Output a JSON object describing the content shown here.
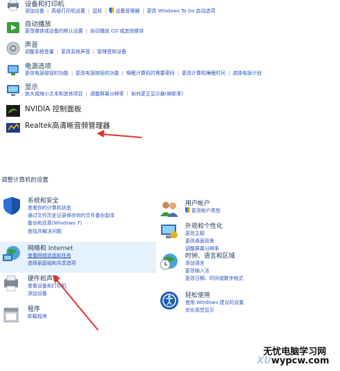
{
  "top_categories": [
    {
      "title": "设备和打印机",
      "icon": "printer-icon",
      "links": [
        "添加设备",
        "高级打印机设置",
        "鼠标",
        "设备管理器",
        "更改 Windows To Go 启动选项"
      ]
    },
    {
      "title": "自动播放",
      "icon": "autoplay-icon",
      "links": [
        "更改媒体或设备的默认设置",
        "自动播放 CD 或其他媒体"
      ]
    },
    {
      "title": "声音",
      "icon": "speaker-icon",
      "links": [
        "调整系统音量",
        "更改系统声音",
        "管理音频设备"
      ]
    },
    {
      "title": "电源选项",
      "icon": "power-icon",
      "links": [
        "更改电源按钮的功能",
        "更改电源按钮的功能",
        "唤醒计算机时需要密码",
        "更改计算机睡眠时间",
        "选择电源计划"
      ]
    },
    {
      "title": "显示",
      "icon": "display-icon",
      "links": [
        "放大或缩小文本和其他项目",
        "调整屏幕分辨率",
        "如何更正显示器(刷新率)"
      ]
    },
    {
      "title": "NVIDIA 控制面板",
      "icon": "nvidia-icon",
      "links": []
    },
    {
      "title": "Realtek高清晰音频管理器",
      "icon": "realtek-icon",
      "links": []
    }
  ],
  "section_heading": "调整计算机的设置",
  "left_column": [
    {
      "title": "系统和安全",
      "icon": "shield-icon",
      "links": [
        "查看你的计算机状态",
        "通过文件历史记录保存你的文件备份副本",
        "备份和还原(Windows 7)",
        "查找并解决问题"
      ]
    },
    {
      "title": "网络和 Internet",
      "icon": "network-icon",
      "links": [
        "查看网络状态和任务",
        "选择家庭组和共享选项"
      ]
    },
    {
      "title": "硬件和声音",
      "icon": "hardware-icon",
      "links": [
        "查看设备和打印机",
        "添加设备"
      ]
    },
    {
      "title": "程序",
      "icon": "programs-icon",
      "links": [
        "卸载程序"
      ]
    }
  ],
  "right_column": [
    {
      "title": "用户帐户",
      "icon": "users-icon",
      "links": [
        "更改帐户类型"
      ]
    },
    {
      "title": "外观和个性化",
      "icon": "appearance-icon",
      "links": [
        "更改主题",
        "更改桌面背景",
        "调整屏幕分辨率"
      ]
    },
    {
      "title": "时钟、语言和区域",
      "icon": "clock-globe-icon",
      "links": [
        "添加语言",
        "更改输入法",
        "更改日期、时间或数字格式"
      ]
    },
    {
      "title": "轻松使用",
      "icon": "ease-of-access-icon",
      "links": [
        "使用 Windows 建议的设置",
        "优化视觉显示"
      ]
    }
  ],
  "watermark": {
    "line1": "无忧电脑学习网",
    "line2_prefix": "XU",
    "line2": "wypcw.com"
  },
  "colors": {
    "link": "#2a52be",
    "title": "#1e395b",
    "arrow": "#e0322a",
    "highlight": "#e5f1fb"
  }
}
